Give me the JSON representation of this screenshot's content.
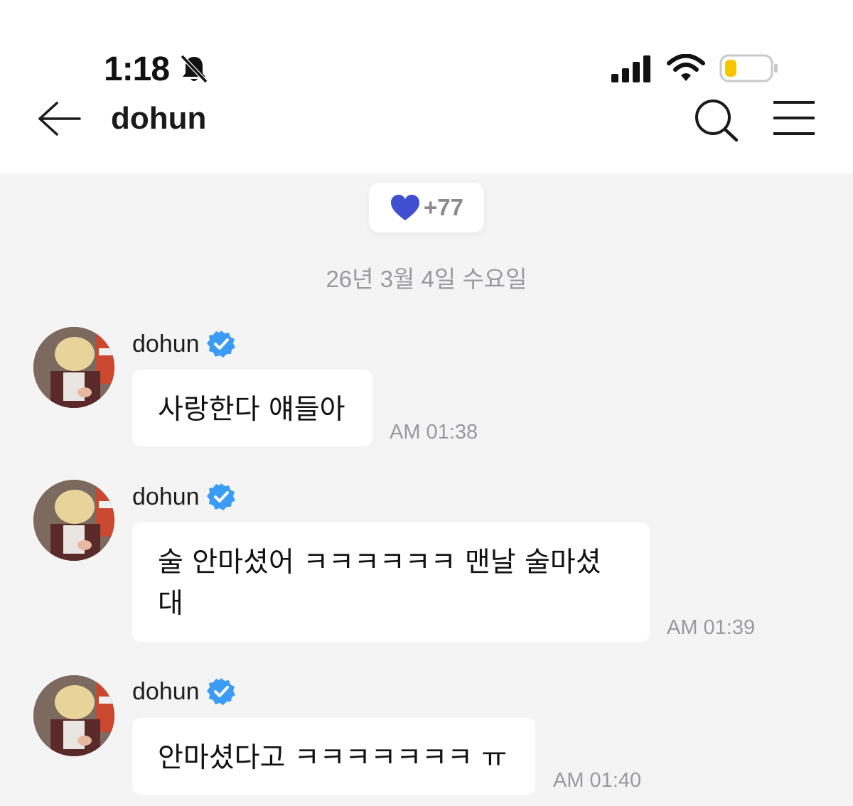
{
  "status_bar": {
    "time": "1:18"
  },
  "header": {
    "title": "dohun"
  },
  "reaction": {
    "count": "+77",
    "color": "#3f4fd0"
  },
  "date_divider": "26년 3월 4일 수요일",
  "messages": [
    {
      "sender": "dohun",
      "text": "사랑한다 얘들아",
      "time": "AM 01:38"
    },
    {
      "sender": "dohun",
      "text_line1": "술 안마셨어 ㅋㅋㅋㅋㅋㅋ 맨날 술마셨",
      "text_line2": "대",
      "time": "AM 01:39"
    },
    {
      "sender": "dohun",
      "text": "안마셨다고 ㅋㅋㅋㅋㅋㅋㅋ ㅠ",
      "time": "AM 01:40"
    }
  ],
  "colors": {
    "verified": "#3b9cf5",
    "battery_fill": "#f7c600"
  }
}
